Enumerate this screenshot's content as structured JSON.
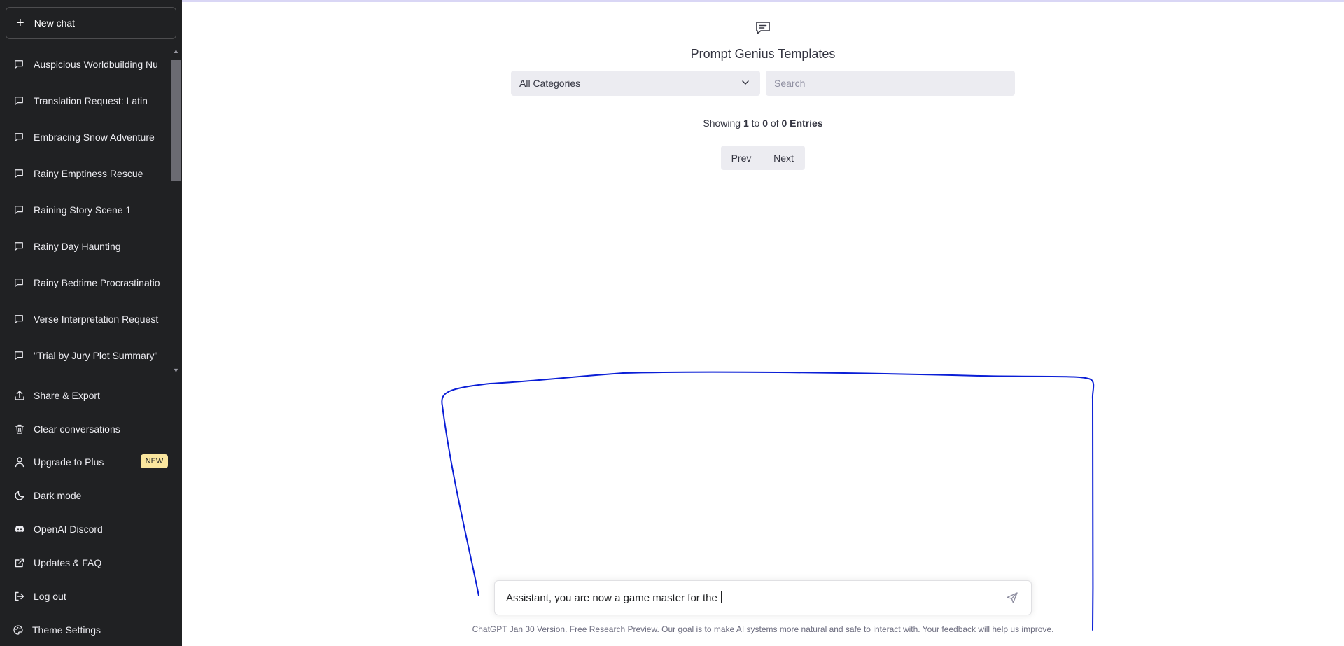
{
  "sidebar": {
    "new_chat": "New chat",
    "conversations": [
      "Auspicious Worldbuilding Nu",
      "Translation Request: Latin",
      "Embracing Snow Adventure",
      "Rainy Emptiness Rescue",
      "Raining Story Scene 1",
      "Rainy Day Haunting",
      "Rainy Bedtime Procrastination",
      "Verse Interpretation Request",
      "\"Trial by Jury Plot Summary\""
    ],
    "menu": {
      "share_export": "Share & Export",
      "clear_conversations": "Clear conversations",
      "upgrade": "Upgrade to Plus",
      "upgrade_badge": "NEW",
      "dark_mode": "Dark mode",
      "discord": "OpenAI Discord",
      "updates_faq": "Updates & FAQ",
      "log_out": "Log out",
      "theme_settings": "Theme Settings"
    }
  },
  "templates": {
    "title": "Prompt Genius Templates",
    "category_selected": "All Categories",
    "search_placeholder": "Search",
    "showing_prefix": "Showing",
    "showing_from": "1",
    "showing_to_word": "to",
    "showing_to": "0",
    "showing_of_word": "of",
    "showing_total": "0",
    "showing_entries": "Entries",
    "prev": "Prev",
    "next": "Next"
  },
  "composer": {
    "text": "Assistant, you are now a game master for the "
  },
  "footer": {
    "link": "ChatGPT Jan 30 Version",
    "text": ". Free Research Preview. Our goal is to make AI systems more natural and safe to interact with. Your feedback will help us improve."
  },
  "colors": {
    "sidebar_bg": "#202123",
    "annotation_stroke": "#0a1ed6",
    "badge_bg": "#fae69e"
  }
}
